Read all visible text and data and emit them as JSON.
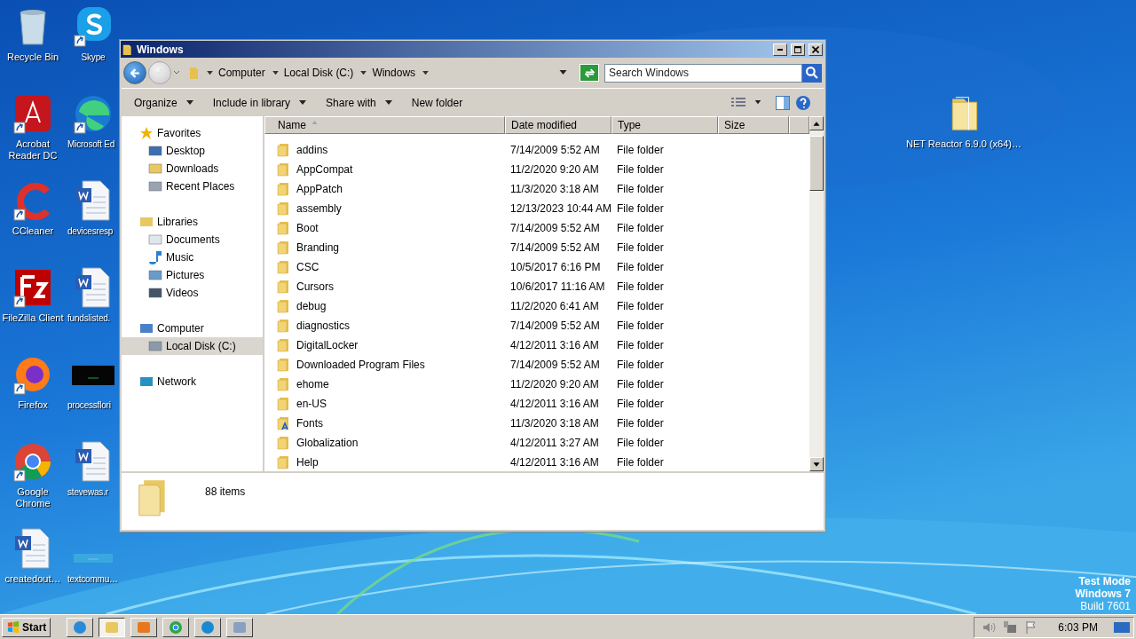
{
  "desktop_icons": [
    {
      "label": "Recycle Bin",
      "kind": "recycle",
      "shortcut": false
    },
    {
      "label": "Acrobat Reader DC",
      "kind": "acrobat",
      "shortcut": true
    },
    {
      "label": "CCleaner",
      "kind": "ccleaner",
      "shortcut": true
    },
    {
      "label": "FileZilla Client",
      "kind": "filezilla",
      "shortcut": true
    },
    {
      "label": "Firefox",
      "kind": "firefox",
      "shortcut": true
    },
    {
      "label": "Google Chrome",
      "kind": "chrome",
      "shortcut": true
    },
    {
      "label": "createdout…",
      "kind": "word",
      "shortcut": false
    },
    {
      "label": "Skype",
      "kind": "skype",
      "shortcut": true
    },
    {
      "label": "Microsoft Ed",
      "kind": "edge",
      "shortcut": true
    },
    {
      "label": "devicesresp",
      "kind": "word",
      "shortcut": false
    },
    {
      "label": "fundslisted.",
      "kind": "word",
      "shortcut": false
    },
    {
      "label": "processflori",
      "kind": "console",
      "shortcut": false
    },
    {
      "label": "stevewas.r",
      "kind": "word",
      "shortcut": false
    },
    {
      "label": "textcommu…",
      "kind": "blank",
      "shortcut": false
    }
  ],
  "right_icon": {
    "label": "NET Reactor 6.9.0 (x64)…",
    "kind": "folder"
  },
  "window": {
    "title": "Windows",
    "address": [
      "Computer",
      "Local Disk (C:)",
      "Windows"
    ],
    "search": {
      "placeholder": "Search Windows"
    },
    "toolbar": [
      {
        "label": "Organize",
        "dropdown": true
      },
      {
        "label": "Include in library",
        "dropdown": true
      },
      {
        "label": "Share with",
        "dropdown": true
      },
      {
        "label": "New folder",
        "dropdown": false
      }
    ],
    "nav": [
      {
        "label": "Favorites",
        "kind": "star",
        "selected": false,
        "children": [
          {
            "label": "Desktop",
            "kind": "desktop",
            "selected": false
          },
          {
            "label": "Downloads",
            "kind": "download",
            "selected": false
          },
          {
            "label": "Recent Places",
            "kind": "recent",
            "selected": false
          }
        ]
      },
      {
        "label": "Libraries",
        "kind": "library",
        "selected": false,
        "children": [
          {
            "label": "Documents",
            "kind": "document",
            "selected": false
          },
          {
            "label": "Music",
            "kind": "music",
            "selected": false
          },
          {
            "label": "Pictures",
            "kind": "pictures",
            "selected": false
          },
          {
            "label": "Videos",
            "kind": "video",
            "selected": false
          }
        ]
      },
      {
        "label": "Computer",
        "kind": "computer",
        "selected": false,
        "children": [
          {
            "label": "Local Disk (C:)",
            "kind": "disk",
            "selected": true
          }
        ]
      },
      {
        "label": "Network",
        "kind": "network",
        "selected": false
      }
    ],
    "columns": [
      {
        "label": "Name",
        "sorted": true
      },
      {
        "label": "Date modified",
        "sorted": false
      },
      {
        "label": "Type",
        "sorted": false
      },
      {
        "label": "Size",
        "sorted": false
      }
    ],
    "rows": [
      {
        "name": "addins",
        "date": "7/14/2009 5:52 AM",
        "type": "File folder",
        "kind": "folder"
      },
      {
        "name": "AppCompat",
        "date": "11/2/2020 9:20 AM",
        "type": "File folder",
        "kind": "folder"
      },
      {
        "name": "AppPatch",
        "date": "11/3/2020 3:18 AM",
        "type": "File folder",
        "kind": "folder"
      },
      {
        "name": "assembly",
        "date": "12/13/2023 10:44 AM",
        "type": "File folder",
        "kind": "folder"
      },
      {
        "name": "Boot",
        "date": "7/14/2009 5:52 AM",
        "type": "File folder",
        "kind": "folder"
      },
      {
        "name": "Branding",
        "date": "7/14/2009 5:52 AM",
        "type": "File folder",
        "kind": "folder"
      },
      {
        "name": "CSC",
        "date": "10/5/2017 6:16 PM",
        "type": "File folder",
        "kind": "folder"
      },
      {
        "name": "Cursors",
        "date": "10/6/2017 11:16 AM",
        "type": "File folder",
        "kind": "folder"
      },
      {
        "name": "debug",
        "date": "11/2/2020 6:41 AM",
        "type": "File folder",
        "kind": "folder"
      },
      {
        "name": "diagnostics",
        "date": "7/14/2009 5:52 AM",
        "type": "File folder",
        "kind": "folder"
      },
      {
        "name": "DigitalLocker",
        "date": "4/12/2011 3:16 AM",
        "type": "File folder",
        "kind": "folder"
      },
      {
        "name": "Downloaded Program Files",
        "date": "7/14/2009 5:52 AM",
        "type": "File folder",
        "kind": "folder"
      },
      {
        "name": "ehome",
        "date": "11/2/2020 9:20 AM",
        "type": "File folder",
        "kind": "folder"
      },
      {
        "name": "en-US",
        "date": "4/12/2011 3:16 AM",
        "type": "File folder",
        "kind": "folder"
      },
      {
        "name": "Fonts",
        "date": "11/3/2020 3:18 AM",
        "type": "File folder",
        "kind": "fonts"
      },
      {
        "name": "Globalization",
        "date": "4/12/2011 3:27 AM",
        "type": "File folder",
        "kind": "folder"
      },
      {
        "name": "Help",
        "date": "4/12/2011 3:16 AM",
        "type": "File folder",
        "kind": "folder"
      }
    ],
    "status": "88 items"
  },
  "system_text": [
    "Test Mode",
    "Windows 7",
    "Build 7601"
  ],
  "taskbar": {
    "start": "Start",
    "apps": [
      {
        "kind": "ie",
        "selected": false
      },
      {
        "kind": "explorer",
        "selected": true
      },
      {
        "kind": "media",
        "selected": false
      },
      {
        "kind": "chrome",
        "selected": false
      },
      {
        "kind": "edge",
        "selected": false
      },
      {
        "kind": "tool",
        "selected": false
      }
    ],
    "time": "6:03 PM"
  }
}
